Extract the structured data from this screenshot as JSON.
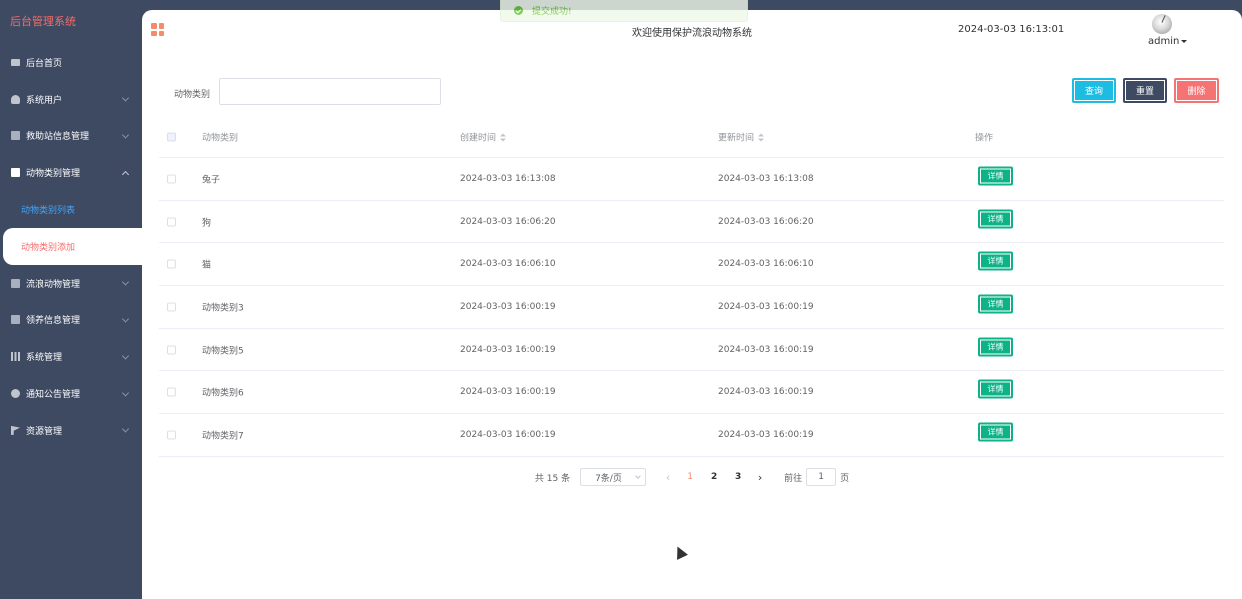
{
  "sidebar": {
    "brand": "后台管理系统",
    "items": [
      {
        "label": "后台首页",
        "icon": "monitor-icon"
      },
      {
        "label": "系统用户",
        "icon": "user-icon"
      },
      {
        "label": "救助站信息管理",
        "icon": "square-icon"
      },
      {
        "label": "动物类别管理",
        "icon": "square-icon"
      },
      {
        "label": "流浪动物管理",
        "icon": "square-icon"
      },
      {
        "label": "领养信息管理",
        "icon": "square-icon"
      },
      {
        "label": "系统管理",
        "icon": "bar-chart-icon"
      },
      {
        "label": "通知公告管理",
        "icon": "info-icon"
      },
      {
        "label": "资源管理",
        "icon": "flag-icon"
      }
    ],
    "subitems": [
      {
        "label": "动物类别列表"
      },
      {
        "label": "动物类别添加"
      }
    ]
  },
  "header": {
    "welcome": "欢迎使用保护流浪动物系统",
    "datetime": "2024-03-03 16:13:01",
    "user": "admin"
  },
  "toast": {
    "message": "提交成功!"
  },
  "filter": {
    "label": "动物类别",
    "value": ""
  },
  "buttons": {
    "query": "查询",
    "reset": "重置",
    "delete": "删除"
  },
  "table": {
    "columns": {
      "type": "动物类别",
      "created": "创建时间",
      "updated": "更新时间",
      "op": "操作"
    },
    "detail_label": "详情",
    "rows": [
      {
        "type": "兔子",
        "created": "2024-03-03 16:13:08",
        "updated": "2024-03-03 16:13:08"
      },
      {
        "type": "狗",
        "created": "2024-03-03 16:06:20",
        "updated": "2024-03-03 16:06:20"
      },
      {
        "type": "猫",
        "created": "2024-03-03 16:06:10",
        "updated": "2024-03-03 16:06:10"
      },
      {
        "type": "动物类别3",
        "created": "2024-03-03 16:00:19",
        "updated": "2024-03-03 16:00:19"
      },
      {
        "type": "动物类别5",
        "created": "2024-03-03 16:00:19",
        "updated": "2024-03-03 16:00:19"
      },
      {
        "type": "动物类别6",
        "created": "2024-03-03 16:00:19",
        "updated": "2024-03-03 16:00:19"
      },
      {
        "type": "动物类别7",
        "created": "2024-03-03 16:00:19",
        "updated": "2024-03-03 16:00:19"
      }
    ]
  },
  "pagination": {
    "total": "共 15 条",
    "page_size": "7条/页",
    "prev": "‹",
    "next": "›",
    "pages": [
      "1",
      "2",
      "3"
    ],
    "goto_prefix": "前往",
    "goto_value": "1",
    "goto_suffix": "页"
  },
  "colors": {
    "sidebar_bg": "#3e4a62",
    "accent": "#f58a6c",
    "query": "#1dbde3",
    "delete": "#f56c6c",
    "detail": "#0db387"
  }
}
